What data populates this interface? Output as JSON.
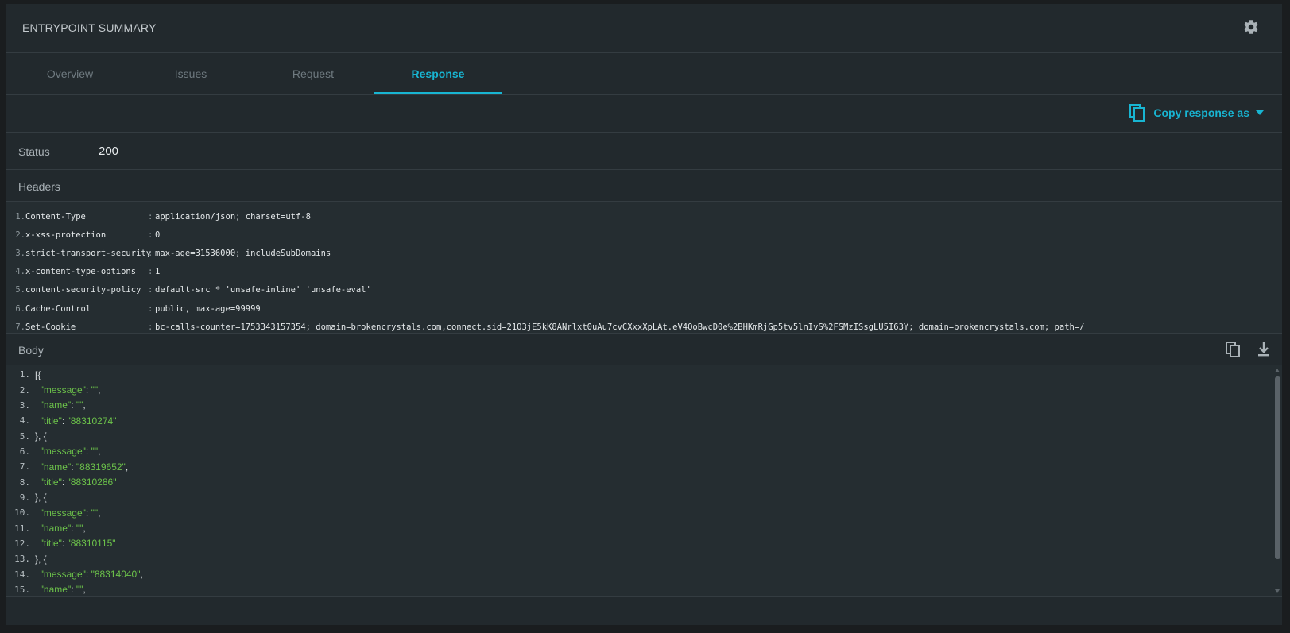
{
  "window": {
    "title": "ENTRYPOINT SUMMARY"
  },
  "tabs": [
    {
      "label": "Overview",
      "active": false
    },
    {
      "label": "Issues",
      "active": false
    },
    {
      "label": "Request",
      "active": false
    },
    {
      "label": "Response",
      "active": true
    }
  ],
  "toolbar": {
    "copy_label": "Copy response as"
  },
  "status": {
    "label": "Status",
    "value": "200"
  },
  "headers": {
    "label": "Headers",
    "rows": [
      {
        "num": "1.",
        "key": "Content-Type",
        "value": "application/json; charset=utf-8"
      },
      {
        "num": "2.",
        "key": "x-xss-protection",
        "value": "0"
      },
      {
        "num": "3.",
        "key": "strict-transport-security",
        "value": "max-age=31536000; includeSubDomains"
      },
      {
        "num": "4.",
        "key": "x-content-type-options",
        "value": "1"
      },
      {
        "num": "5.",
        "key": "content-security-policy",
        "value": "default-src * 'unsafe-inline' 'unsafe-eval'"
      },
      {
        "num": "6.",
        "key": "Cache-Control",
        "value": "public, max-age=99999"
      },
      {
        "num": "7.",
        "key": "Set-Cookie",
        "value": "bc-calls-counter=1753343157354; domain=brokencrystals.com,connect.sid=21O3jE5kK8ANrlxt0uAu7cvCXxxXpLAt.eV4QoBwcD0e%2BHKmRjGp5tv5lnIvS%2FSMzISsgLU5I63Y; domain=brokencrystals.com; path=/"
      }
    ]
  },
  "body": {
    "label": "Body",
    "lines": [
      {
        "num": "1.",
        "indent": "",
        "key": "",
        "value": "",
        "text": "[{"
      },
      {
        "num": "2.",
        "indent": "  ",
        "key": "\"message\"",
        "value": "\"\"",
        "text": ","
      },
      {
        "num": "3.",
        "indent": "  ",
        "key": "\"name\"",
        "value": "\"\"",
        "text": ","
      },
      {
        "num": "4.",
        "indent": "  ",
        "key": "\"title\"",
        "value": "\"88310274\"",
        "text": ""
      },
      {
        "num": "5.",
        "indent": "",
        "key": "",
        "value": "",
        "text": "}, {"
      },
      {
        "num": "6.",
        "indent": "  ",
        "key": "\"message\"",
        "value": "\"\"",
        "text": ","
      },
      {
        "num": "7.",
        "indent": "  ",
        "key": "\"name\"",
        "value": "\"88319652\"",
        "text": ","
      },
      {
        "num": "8.",
        "indent": "  ",
        "key": "\"title\"",
        "value": "\"88310286\"",
        "text": ""
      },
      {
        "num": "9.",
        "indent": "",
        "key": "",
        "value": "",
        "text": "}, {"
      },
      {
        "num": "10.",
        "indent": "  ",
        "key": "\"message\"",
        "value": "\"\"",
        "text": ","
      },
      {
        "num": "11.",
        "indent": "  ",
        "key": "\"name\"",
        "value": "\"\"",
        "text": ","
      },
      {
        "num": "12.",
        "indent": "  ",
        "key": "\"title\"",
        "value": "\"88310115\"",
        "text": ""
      },
      {
        "num": "13.",
        "indent": "",
        "key": "",
        "value": "",
        "text": "}, {"
      },
      {
        "num": "14.",
        "indent": "  ",
        "key": "\"message\"",
        "value": "\"88314040\"",
        "text": ","
      },
      {
        "num": "15.",
        "indent": "  ",
        "key": "\"name\"",
        "value": "\"\"",
        "text": ","
      }
    ]
  },
  "colors": {
    "accent": "#18b5d2",
    "json_green": "#6cc24a",
    "panel": "#22292d"
  }
}
